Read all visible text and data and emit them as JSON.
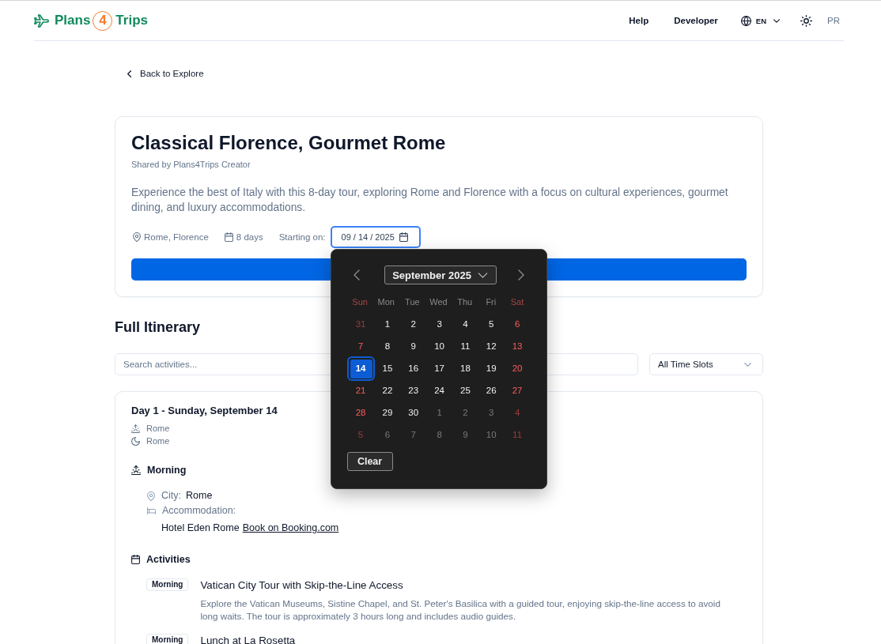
{
  "header": {
    "logo": {
      "prefix": "Plans",
      "number": "4",
      "suffix": "Trips"
    },
    "nav": [
      "Help",
      "Developer"
    ],
    "language": "EN",
    "profile": "PR"
  },
  "back_link": "Back to Explore",
  "trip": {
    "title": "Classical Florence, Gourmet Rome",
    "shared_by": "Shared by Plans4Trips Creator",
    "description": "Experience the best of Italy with this 8-day tour, exploring Rome and Florence with a focus on cultural experiences, gourmet dining, and luxury accommodations.",
    "location": "Rome, Florence",
    "duration": "8 days",
    "start_label": "Starting on:",
    "start_date": {
      "value": "09 / 14 / 2025",
      "focused": true
    }
  },
  "date_picker": {
    "month": "September 2025",
    "weekdays": [
      {
        "label": "Sun",
        "weekend": true
      },
      {
        "label": "Mon",
        "weekend": false
      },
      {
        "label": "Tue",
        "weekend": false
      },
      {
        "label": "Wed",
        "weekend": false
      },
      {
        "label": "Thu",
        "weekend": false
      },
      {
        "label": "Fri",
        "weekend": false
      },
      {
        "label": "Sat",
        "weekend": true
      }
    ],
    "weeks": [
      [
        {
          "label": "31",
          "in_month": false,
          "selected": false
        },
        {
          "label": "1",
          "in_month": true,
          "selected": false
        },
        {
          "label": "2",
          "in_month": true,
          "selected": false
        },
        {
          "label": "3",
          "in_month": true,
          "selected": false
        },
        {
          "label": "4",
          "in_month": true,
          "selected": false
        },
        {
          "label": "5",
          "in_month": true,
          "selected": false
        },
        {
          "label": "6",
          "in_month": true,
          "selected": false
        }
      ],
      [
        {
          "label": "7",
          "in_month": true,
          "selected": false
        },
        {
          "label": "8",
          "in_month": true,
          "selected": false
        },
        {
          "label": "9",
          "in_month": true,
          "selected": false
        },
        {
          "label": "10",
          "in_month": true,
          "selected": false
        },
        {
          "label": "11",
          "in_month": true,
          "selected": false
        },
        {
          "label": "12",
          "in_month": true,
          "selected": false
        },
        {
          "label": "13",
          "in_month": true,
          "selected": false
        }
      ],
      [
        {
          "label": "14",
          "in_month": true,
          "selected": true
        },
        {
          "label": "15",
          "in_month": true,
          "selected": false
        },
        {
          "label": "16",
          "in_month": true,
          "selected": false
        },
        {
          "label": "17",
          "in_month": true,
          "selected": false
        },
        {
          "label": "18",
          "in_month": true,
          "selected": false
        },
        {
          "label": "19",
          "in_month": true,
          "selected": false
        },
        {
          "label": "20",
          "in_month": true,
          "selected": false
        }
      ],
      [
        {
          "label": "21",
          "in_month": true,
          "selected": false
        },
        {
          "label": "22",
          "in_month": true,
          "selected": false
        },
        {
          "label": "23",
          "in_month": true,
          "selected": false
        },
        {
          "label": "24",
          "in_month": true,
          "selected": false
        },
        {
          "label": "25",
          "in_month": true,
          "selected": false
        },
        {
          "label": "26",
          "in_month": true,
          "selected": false
        },
        {
          "label": "27",
          "in_month": true,
          "selected": false
        }
      ],
      [
        {
          "label": "28",
          "in_month": true,
          "selected": false
        },
        {
          "label": "29",
          "in_month": true,
          "selected": false
        },
        {
          "label": "30",
          "in_month": true,
          "selected": false
        },
        {
          "label": "1",
          "in_month": false,
          "selected": false
        },
        {
          "label": "2",
          "in_month": false,
          "selected": false
        },
        {
          "label": "3",
          "in_month": false,
          "selected": false
        },
        {
          "label": "4",
          "in_month": false,
          "selected": false
        }
      ],
      [
        {
          "label": "5",
          "in_month": false,
          "selected": false
        },
        {
          "label": "6",
          "in_month": false,
          "selected": false
        },
        {
          "label": "7",
          "in_month": false,
          "selected": false
        },
        {
          "label": "8",
          "in_month": false,
          "selected": false
        },
        {
          "label": "9",
          "in_month": false,
          "selected": false
        },
        {
          "label": "10",
          "in_month": false,
          "selected": false
        },
        {
          "label": "11",
          "in_month": false,
          "selected": false
        }
      ]
    ],
    "clear": "Clear"
  },
  "itinerary": {
    "title": "Full Itinerary",
    "search": {
      "placeholder": "Search activities..."
    },
    "time_filter": {
      "value": "All Time Slots"
    },
    "days": [
      {
        "title": "Day 1 - Sunday, September 14",
        "start_city": "Rome",
        "end_city": "Rome",
        "period": "Morning",
        "city_label": "City:",
        "city": "Rome",
        "accommodation_label": "Accommodation:",
        "hotel": "Hotel Eden Rome",
        "booking_link": "Book on Booking.com",
        "activities_title": "Activities",
        "activities": [
          {
            "slot": "Morning",
            "title": "Vatican City Tour with Skip-the-Line Access",
            "description": "Explore the Vatican Museums, Sistine Chapel, and St. Peter's Basilica with a guided tour, enjoying skip-the-line access to avoid long waits. The tour is approximately 3 hours long and includes audio guides."
          },
          {
            "slot": "Morning",
            "title": "Lunch at La Rosetta"
          }
        ]
      }
    ]
  }
}
